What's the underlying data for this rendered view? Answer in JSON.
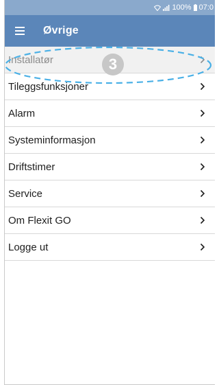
{
  "statusbar": {
    "battery": "100%",
    "time": "07:0"
  },
  "appbar": {
    "title": "Øvrige",
    "menu_icon": "hamburger-menu-icon"
  },
  "menu": {
    "items": [
      {
        "label": "Installatør"
      },
      {
        "label": "Tileggsfunksjoner"
      },
      {
        "label": "Alarm"
      },
      {
        "label": "Systeminformasjon"
      },
      {
        "label": "Driftstimer"
      },
      {
        "label": "Service"
      },
      {
        "label": "Om Flexit GO"
      },
      {
        "label": "Logge ut"
      }
    ],
    "chevron_icon": "chevron-right-icon"
  },
  "annotation": {
    "step_number": "3",
    "highlight_color": "#4ab0e6"
  }
}
